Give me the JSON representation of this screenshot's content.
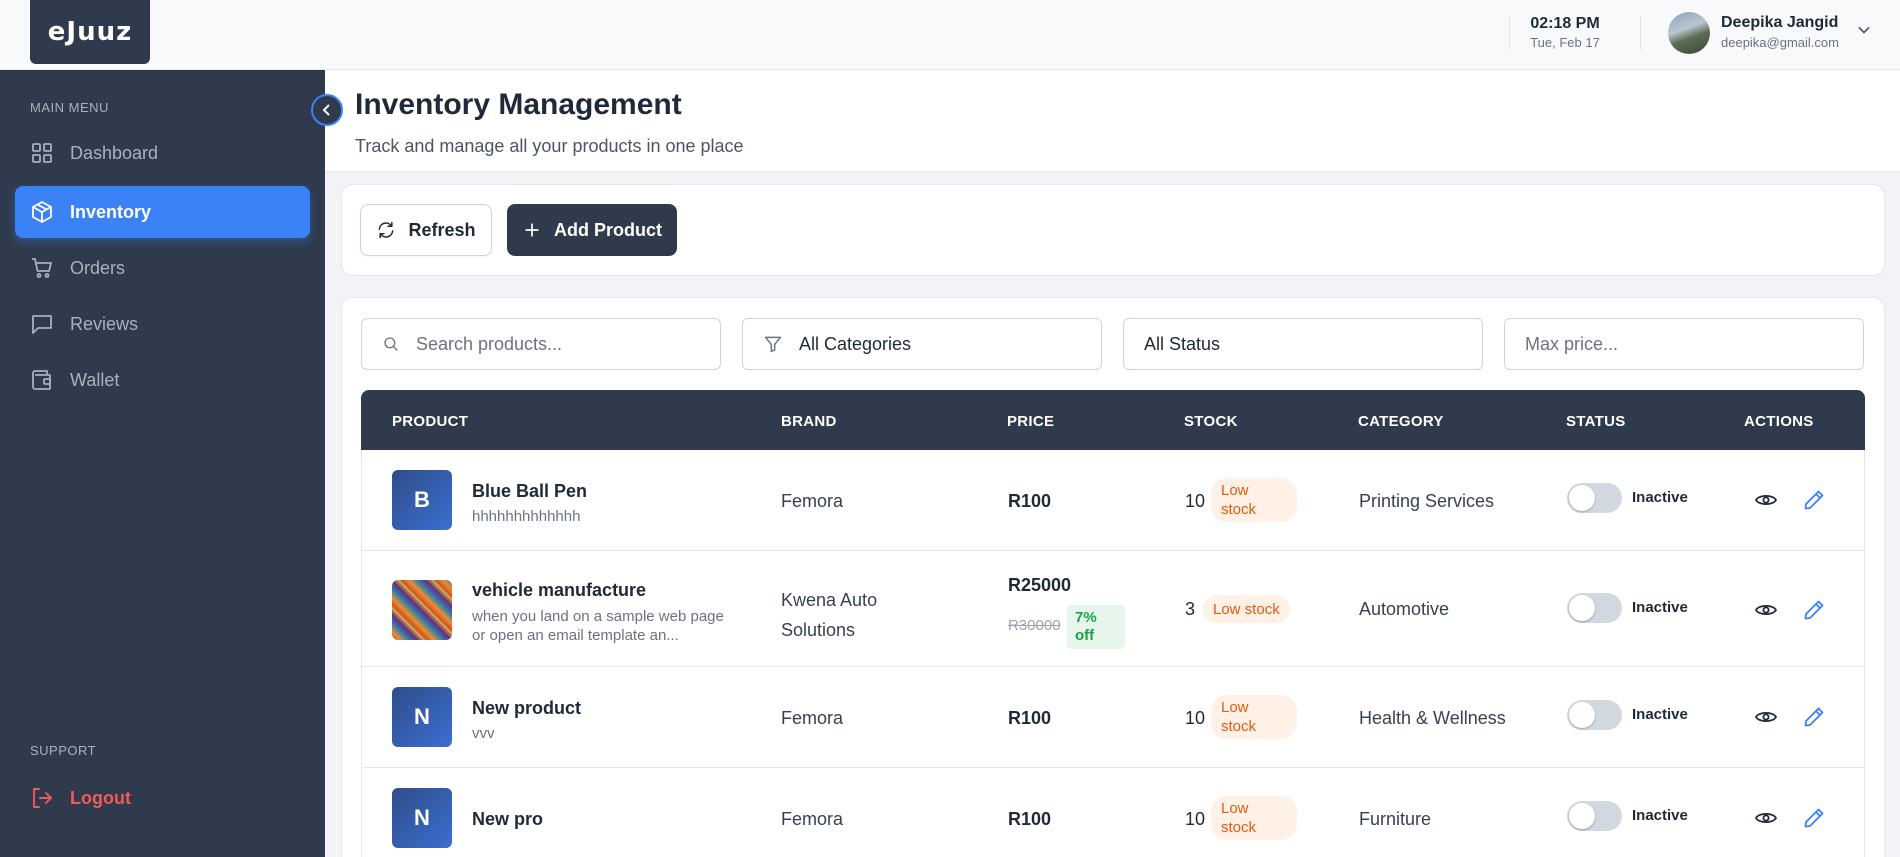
{
  "brand": {
    "logo_text": "eJuuz"
  },
  "topbar": {
    "time": "02:18 PM",
    "date": "Tue, Feb 17",
    "user_name": "Deepika Jangid",
    "user_email": "deepika@gmail.com"
  },
  "sidebar": {
    "main_menu_label": "MAIN MENU",
    "items": [
      {
        "label": "Dashboard",
        "icon": "dashboard-grid-icon",
        "active": false
      },
      {
        "label": "Inventory",
        "icon": "box-icon",
        "active": true
      },
      {
        "label": "Orders",
        "icon": "cart-icon",
        "active": false
      },
      {
        "label": "Reviews",
        "icon": "message-icon",
        "active": false
      },
      {
        "label": "Wallet",
        "icon": "wallet-icon",
        "active": false
      }
    ],
    "support_label": "SUPPORT",
    "logout_label": "Logout"
  },
  "page": {
    "title": "Inventory Management",
    "subtitle": "Track and manage all your products in one place"
  },
  "toolbar": {
    "refresh_label": "Refresh",
    "add_label": "Add Product"
  },
  "filters": {
    "search_placeholder": "Search products...",
    "category_value": "All Categories",
    "status_value": "All Status",
    "price_placeholder": "Max price..."
  },
  "table": {
    "columns": [
      "PRODUCT",
      "BRAND",
      "PRICE",
      "STOCK",
      "CATEGORY",
      "STATUS",
      "ACTIONS"
    ],
    "rows": [
      {
        "initial": "B",
        "name": "Blue Ball Pen",
        "desc": "hhhhhhhhhhhhh",
        "brand": "Femora",
        "price": "R100",
        "stock": "10",
        "stock_badge": "Low stock",
        "category": "Printing Services",
        "status": "Inactive"
      },
      {
        "initial": "",
        "name": "vehicle manufacture",
        "desc": "when you land on a sample web page or open an email template an...",
        "brand": "Kwena Auto Solutions",
        "price": "R25000",
        "old_price": "R30000",
        "discount": "7% off",
        "stock": "3",
        "stock_badge": "Low stock",
        "category": "Automotive",
        "status": "Inactive"
      },
      {
        "initial": "N",
        "name": "New product",
        "desc": "vvv",
        "brand": "Femora",
        "price": "R100",
        "stock": "10",
        "stock_badge": "Low stock",
        "category": "Health & Wellness",
        "status": "Inactive"
      },
      {
        "initial": "N",
        "name": "New pro",
        "desc": "",
        "brand": "Femora",
        "price": "R100",
        "stock": "10",
        "stock_badge": "Low stock",
        "category": "Furniture",
        "status": "Inactive"
      }
    ]
  },
  "colors": {
    "sidebar_bg": "#2f3b4c",
    "accent": "#3b82f6",
    "low_stock": "#ea580c",
    "discount": "#16a34a",
    "logout": "#f05a5a"
  }
}
